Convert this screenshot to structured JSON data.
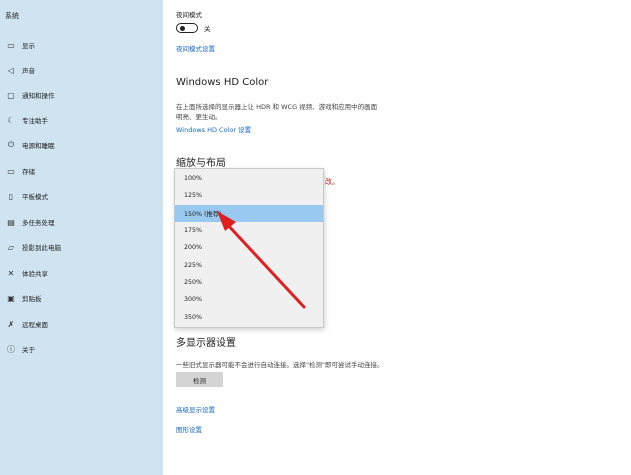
{
  "sidebar": {
    "title": "系统",
    "items": [
      {
        "label": "显示",
        "icon": "monitor-icon",
        "glyph": "▭"
      },
      {
        "label": "声音",
        "icon": "speaker-icon",
        "glyph": "◁"
      },
      {
        "label": "通知和操作",
        "icon": "notification-icon",
        "glyph": "▢"
      },
      {
        "label": "专注助手",
        "icon": "moon-icon",
        "glyph": "☾"
      },
      {
        "label": "电源和睡眠",
        "icon": "power-icon",
        "glyph": "⏻"
      },
      {
        "label": "存储",
        "icon": "storage-icon",
        "glyph": "▭"
      },
      {
        "label": "平板模式",
        "icon": "tablet-icon",
        "glyph": "▯"
      },
      {
        "label": "多任务处理",
        "icon": "multitask-icon",
        "glyph": "▤"
      },
      {
        "label": "投影到此电脑",
        "icon": "project-icon",
        "glyph": "▱"
      },
      {
        "label": "体验共享",
        "icon": "share-icon",
        "glyph": "✕"
      },
      {
        "label": "剪贴板",
        "icon": "clipboard-icon",
        "glyph": "▣"
      },
      {
        "label": "远程桌面",
        "icon": "remote-icon",
        "glyph": "✗"
      },
      {
        "label": "关于",
        "icon": "info-icon",
        "glyph": "ⓘ"
      }
    ]
  },
  "main": {
    "night_mode_label": "夜间模式",
    "night_mode_state": "关",
    "night_mode_settings_link": "夜间模式设置",
    "hdr_title": "Windows HD Color",
    "hdr_desc_line1": "在上面所选择的显示器上让 HDR 和 WCG 视频、游戏和应用中的画面",
    "hdr_desc_line2": "明亮、更生动。",
    "hdr_link": "Windows HD Color 设置",
    "scale_title": "缩放与布局",
    "red_fragment": "改。",
    "multi_display_title": "多显示器设置",
    "multi_display_desc": "一些旧式显示器可能不会进行自动连接。选择\"检测\"即可尝试手动连接。",
    "detect_button": "检测",
    "advanced_display_link": "高级显示设置",
    "graphics_link": "图形设置"
  },
  "scale_dropdown": {
    "options": [
      "100%",
      "125%",
      "150% (推荐)",
      "175%",
      "200%",
      "225%",
      "250%",
      "300%",
      "350%"
    ],
    "selected_index": 2
  },
  "colors": {
    "sidebar_bg": "#cfe3f1",
    "link": "#1a67c2",
    "selected_option": "#99c9f1",
    "arrow": "#e02020"
  }
}
